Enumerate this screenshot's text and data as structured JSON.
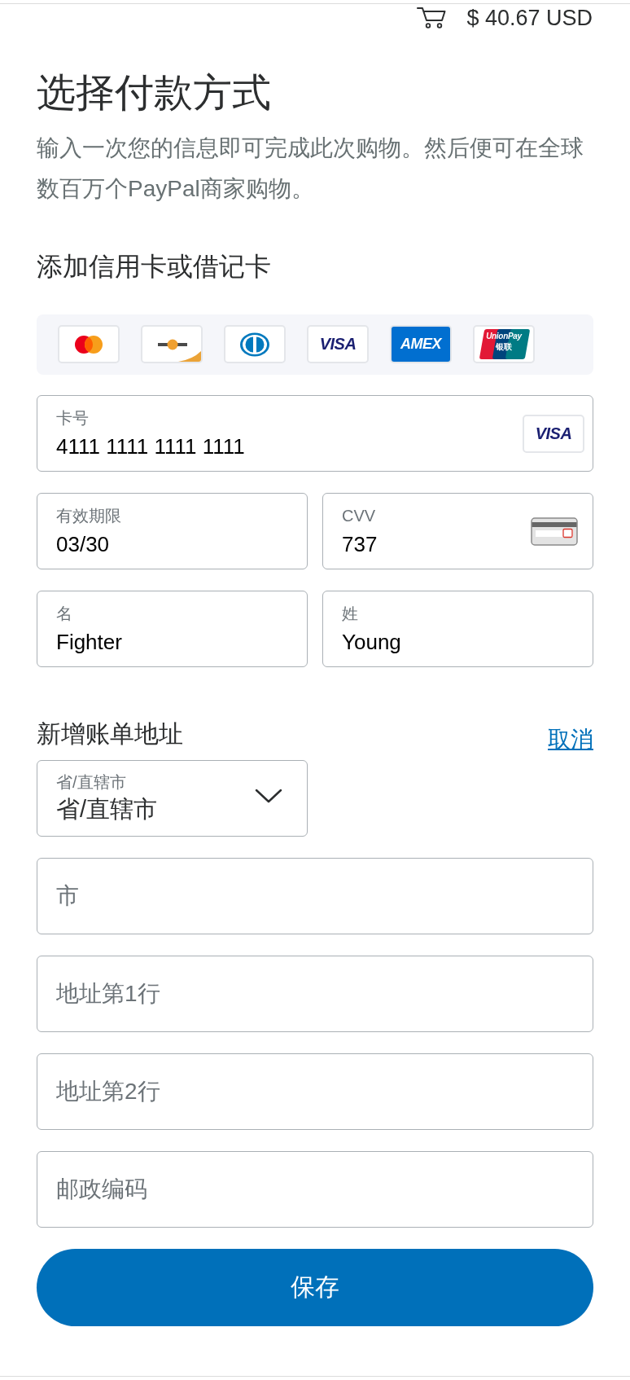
{
  "header": {
    "amount": "$ 40.67 USD"
  },
  "title": "选择付款方式",
  "description": "输入一次您的信息即可完成此次购物。然后便可在全球数百万个PayPal商家购物。",
  "card_form": {
    "heading": "添加信用卡或借记卡",
    "accepted_cards": [
      {
        "kind": "mastercard"
      },
      {
        "kind": "discover"
      },
      {
        "kind": "diners"
      },
      {
        "kind": "visa",
        "text": "VISA"
      },
      {
        "kind": "amex",
        "text": "AMEX"
      },
      {
        "kind": "unionpay",
        "text": "UnionPay",
        "subtext": "银联"
      }
    ],
    "rows": [
      {
        "fields": [
          {
            "label": "卡号",
            "value": "4111 1111 1111 1111",
            "accessory": {
              "kind": "visa",
              "text": "VISA"
            }
          }
        ]
      },
      {
        "fields": [
          {
            "label": "有效期限",
            "value": "03/30"
          },
          {
            "label": "CVV",
            "value": "737",
            "accessory": {
              "kind": "cvv_card"
            }
          }
        ]
      },
      {
        "fields": [
          {
            "label": "名",
            "value": "Fighter"
          },
          {
            "label": "姓",
            "value": "Young"
          }
        ]
      }
    ]
  },
  "billing": {
    "heading": "新增账单地址",
    "cancel_link": "取消",
    "province": {
      "label": "省/直辖市",
      "value": "省/直辖市"
    },
    "fields": [
      {
        "placeholder": "市"
      },
      {
        "placeholder": "地址第1行"
      },
      {
        "placeholder": "地址第2行"
      },
      {
        "placeholder": "邮政编码"
      }
    ]
  },
  "save_button": "保存"
}
